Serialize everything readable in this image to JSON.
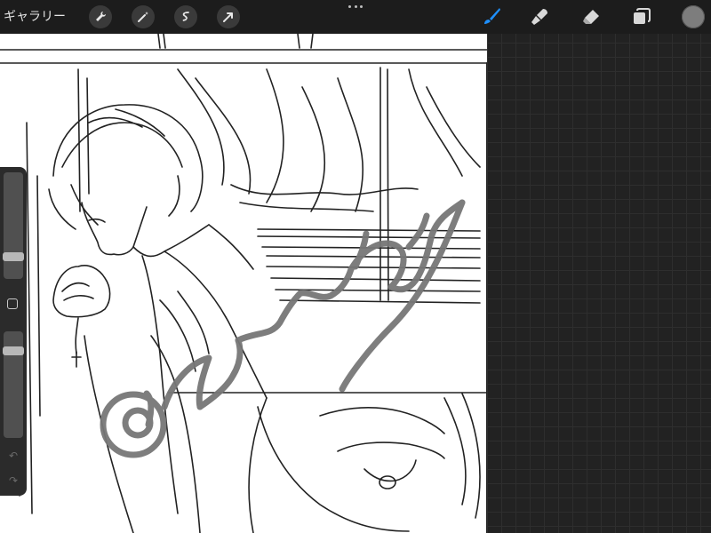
{
  "app": {
    "gallery_label": "ギャラリー",
    "left_tools": [
      "wrench-icon",
      "magic-wand-icon",
      "selection-icon",
      "transform-arrow-icon"
    ],
    "right_tools": [
      "brush-icon",
      "smudge-icon",
      "eraser-icon",
      "layers-icon"
    ],
    "active_tool": "brush-icon",
    "accent_color": "#1e90ff",
    "current_color": "#7d7d7d"
  },
  "sidebar": {
    "brush_size_level": 0.18,
    "opacity_level": 0.85,
    "undo_icon": "↶",
    "redo_icon": "↷"
  },
  "artwork": {
    "watermark_color": "#777777"
  }
}
